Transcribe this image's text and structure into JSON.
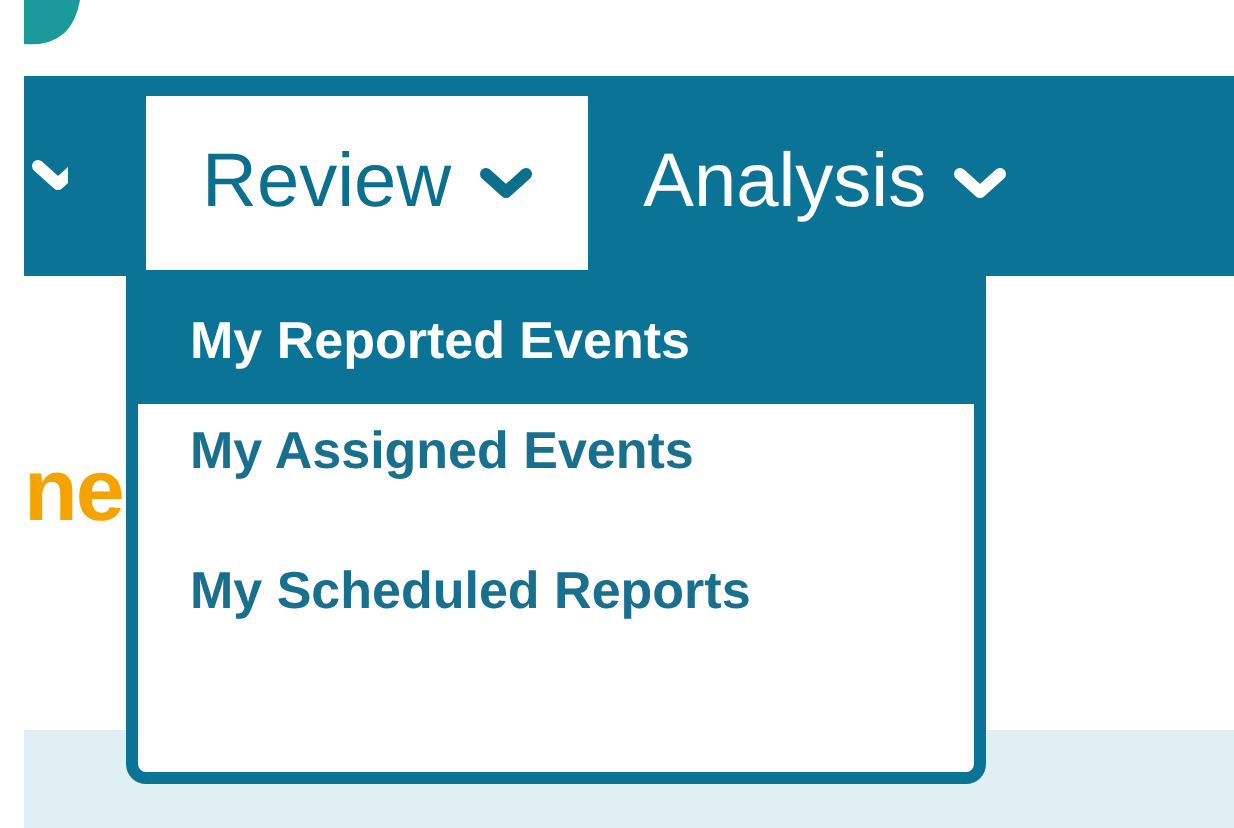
{
  "nav": {
    "items": [
      {
        "label": "Review",
        "selected": true
      },
      {
        "label": "Analysis",
        "selected": false
      }
    ]
  },
  "dropdown": {
    "items": [
      {
        "label": "My Reported Events",
        "selected": true
      },
      {
        "label": "My Assigned Events",
        "selected": false
      },
      {
        "label": "My Scheduled Reports",
        "selected": false
      }
    ]
  },
  "page_heading": "ne"
}
